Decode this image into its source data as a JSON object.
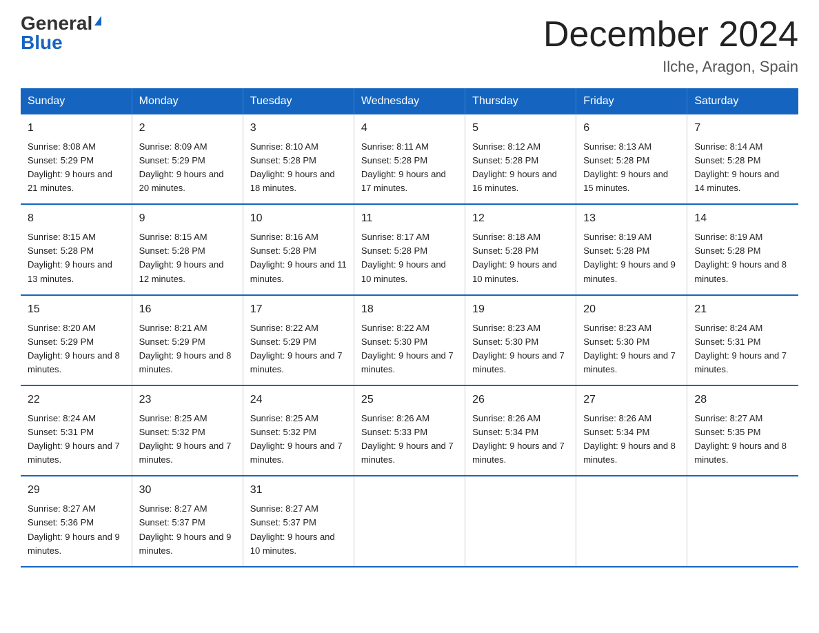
{
  "logo": {
    "general": "General",
    "blue": "Blue"
  },
  "title": "December 2024",
  "location": "Ilche, Aragon, Spain",
  "days_of_week": [
    "Sunday",
    "Monday",
    "Tuesday",
    "Wednesday",
    "Thursday",
    "Friday",
    "Saturday"
  ],
  "weeks": [
    [
      {
        "day": "1",
        "sunrise": "8:08 AM",
        "sunset": "5:29 PM",
        "daylight": "9 hours and 21 minutes."
      },
      {
        "day": "2",
        "sunrise": "8:09 AM",
        "sunset": "5:29 PM",
        "daylight": "9 hours and 20 minutes."
      },
      {
        "day": "3",
        "sunrise": "8:10 AM",
        "sunset": "5:28 PM",
        "daylight": "9 hours and 18 minutes."
      },
      {
        "day": "4",
        "sunrise": "8:11 AM",
        "sunset": "5:28 PM",
        "daylight": "9 hours and 17 minutes."
      },
      {
        "day": "5",
        "sunrise": "8:12 AM",
        "sunset": "5:28 PM",
        "daylight": "9 hours and 16 minutes."
      },
      {
        "day": "6",
        "sunrise": "8:13 AM",
        "sunset": "5:28 PM",
        "daylight": "9 hours and 15 minutes."
      },
      {
        "day": "7",
        "sunrise": "8:14 AM",
        "sunset": "5:28 PM",
        "daylight": "9 hours and 14 minutes."
      }
    ],
    [
      {
        "day": "8",
        "sunrise": "8:15 AM",
        "sunset": "5:28 PM",
        "daylight": "9 hours and 13 minutes."
      },
      {
        "day": "9",
        "sunrise": "8:15 AM",
        "sunset": "5:28 PM",
        "daylight": "9 hours and 12 minutes."
      },
      {
        "day": "10",
        "sunrise": "8:16 AM",
        "sunset": "5:28 PM",
        "daylight": "9 hours and 11 minutes."
      },
      {
        "day": "11",
        "sunrise": "8:17 AM",
        "sunset": "5:28 PM",
        "daylight": "9 hours and 10 minutes."
      },
      {
        "day": "12",
        "sunrise": "8:18 AM",
        "sunset": "5:28 PM",
        "daylight": "9 hours and 10 minutes."
      },
      {
        "day": "13",
        "sunrise": "8:19 AM",
        "sunset": "5:28 PM",
        "daylight": "9 hours and 9 minutes."
      },
      {
        "day": "14",
        "sunrise": "8:19 AM",
        "sunset": "5:28 PM",
        "daylight": "9 hours and 8 minutes."
      }
    ],
    [
      {
        "day": "15",
        "sunrise": "8:20 AM",
        "sunset": "5:29 PM",
        "daylight": "9 hours and 8 minutes."
      },
      {
        "day": "16",
        "sunrise": "8:21 AM",
        "sunset": "5:29 PM",
        "daylight": "9 hours and 8 minutes."
      },
      {
        "day": "17",
        "sunrise": "8:22 AM",
        "sunset": "5:29 PM",
        "daylight": "9 hours and 7 minutes."
      },
      {
        "day": "18",
        "sunrise": "8:22 AM",
        "sunset": "5:30 PM",
        "daylight": "9 hours and 7 minutes."
      },
      {
        "day": "19",
        "sunrise": "8:23 AM",
        "sunset": "5:30 PM",
        "daylight": "9 hours and 7 minutes."
      },
      {
        "day": "20",
        "sunrise": "8:23 AM",
        "sunset": "5:30 PM",
        "daylight": "9 hours and 7 minutes."
      },
      {
        "day": "21",
        "sunrise": "8:24 AM",
        "sunset": "5:31 PM",
        "daylight": "9 hours and 7 minutes."
      }
    ],
    [
      {
        "day": "22",
        "sunrise": "8:24 AM",
        "sunset": "5:31 PM",
        "daylight": "9 hours and 7 minutes."
      },
      {
        "day": "23",
        "sunrise": "8:25 AM",
        "sunset": "5:32 PM",
        "daylight": "9 hours and 7 minutes."
      },
      {
        "day": "24",
        "sunrise": "8:25 AM",
        "sunset": "5:32 PM",
        "daylight": "9 hours and 7 minutes."
      },
      {
        "day": "25",
        "sunrise": "8:26 AM",
        "sunset": "5:33 PM",
        "daylight": "9 hours and 7 minutes."
      },
      {
        "day": "26",
        "sunrise": "8:26 AM",
        "sunset": "5:34 PM",
        "daylight": "9 hours and 7 minutes."
      },
      {
        "day": "27",
        "sunrise": "8:26 AM",
        "sunset": "5:34 PM",
        "daylight": "9 hours and 8 minutes."
      },
      {
        "day": "28",
        "sunrise": "8:27 AM",
        "sunset": "5:35 PM",
        "daylight": "9 hours and 8 minutes."
      }
    ],
    [
      {
        "day": "29",
        "sunrise": "8:27 AM",
        "sunset": "5:36 PM",
        "daylight": "9 hours and 9 minutes."
      },
      {
        "day": "30",
        "sunrise": "8:27 AM",
        "sunset": "5:37 PM",
        "daylight": "9 hours and 9 minutes."
      },
      {
        "day": "31",
        "sunrise": "8:27 AM",
        "sunset": "5:37 PM",
        "daylight": "9 hours and 10 minutes."
      },
      null,
      null,
      null,
      null
    ]
  ]
}
